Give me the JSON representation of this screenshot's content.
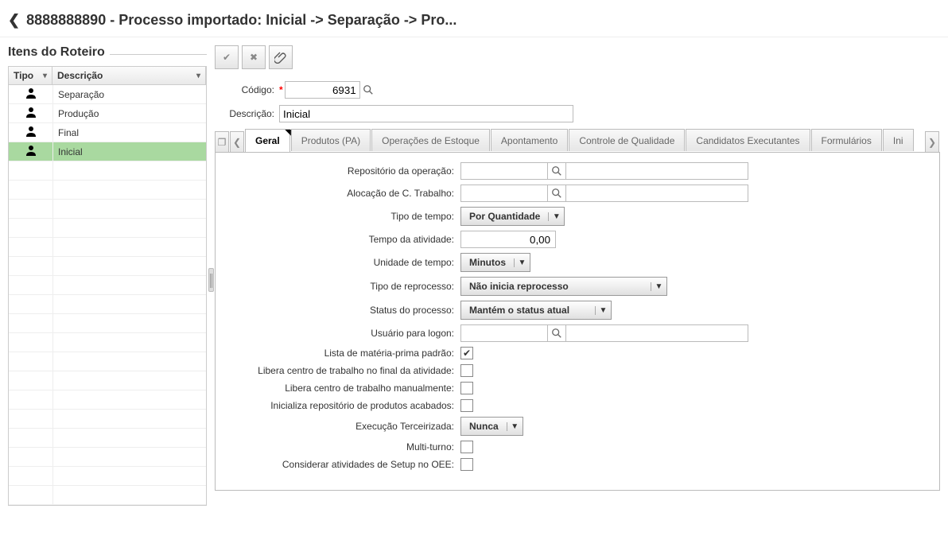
{
  "header": {
    "title": "8888888890 - Processo importado: Inicial -> Separação -> Pro..."
  },
  "left": {
    "title": "Itens do Roteiro",
    "columns": {
      "tipo": "Tipo",
      "descricao": "Descrição"
    },
    "rows": [
      {
        "desc": "Separação",
        "selected": false
      },
      {
        "desc": "Produção",
        "selected": false
      },
      {
        "desc": "Final",
        "selected": false
      },
      {
        "desc": "Inicial",
        "selected": true
      }
    ]
  },
  "formTop": {
    "codigo_label": "Código:",
    "codigo_value": "6931",
    "descricao_label": "Descrição:",
    "descricao_value": "Inicial"
  },
  "tabs": [
    "Geral",
    "Produtos (PA)",
    "Operações de Estoque",
    "Apontamento",
    "Controle de Qualidade",
    "Candidatos Executantes",
    "Formulários",
    "Ini"
  ],
  "form": {
    "repositorio_label": "Repositório da operação:",
    "alocacao_label": "Alocação de C. Trabalho:",
    "tipo_tempo_label": "Tipo de tempo:",
    "tipo_tempo_value": "Por Quantidade",
    "tempo_atividade_label": "Tempo da atividade:",
    "tempo_atividade_value": "0,00",
    "unidade_tempo_label": "Unidade de tempo:",
    "unidade_tempo_value": "Minutos",
    "tipo_reprocesso_label": "Tipo de reprocesso:",
    "tipo_reprocesso_value": "Não inicia reprocesso",
    "status_label": "Status do processo:",
    "status_value": "Mantém o status atual",
    "usuario_logon_label": "Usuário para logon:",
    "lista_mp_label": "Lista de matéria-prima padrão:",
    "lista_mp_checked": true,
    "libera_fim_label": "Libera centro de trabalho no final da atividade:",
    "libera_manual_label": "Libera centro de trabalho manualmente:",
    "inicializa_rep_label": "Inicializa repositório de produtos acabados:",
    "exec_terc_label": "Execução Terceirizada:",
    "exec_terc_value": "Nunca",
    "multi_turno_label": "Multi-turno:",
    "setup_oee_label": "Considerar atividades de Setup no OEE:"
  }
}
